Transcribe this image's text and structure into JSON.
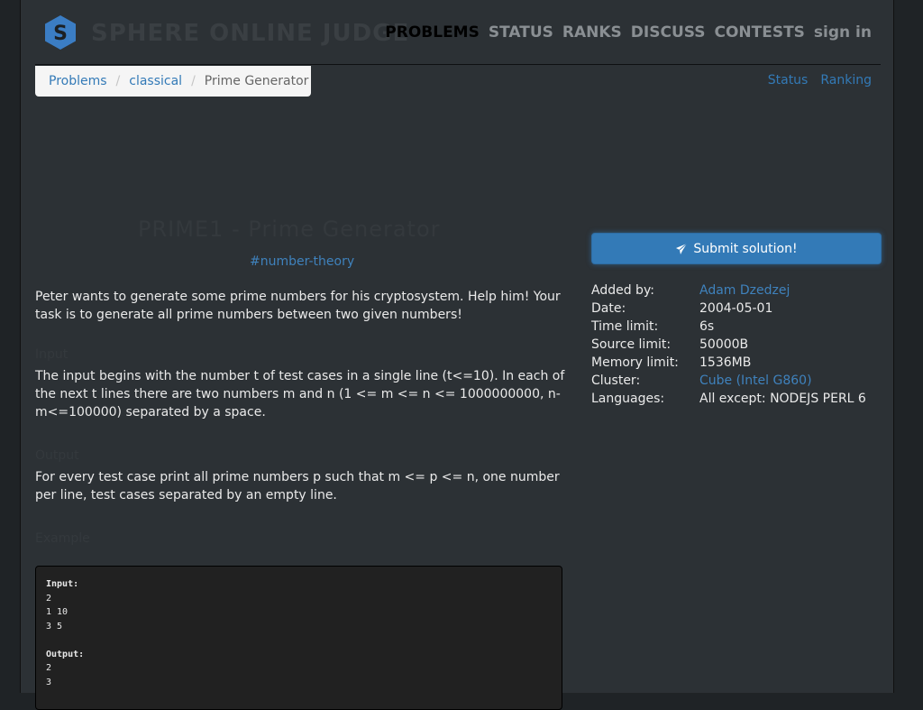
{
  "header": {
    "logo_letter": "S",
    "logo_text": "SPHERE ONLINE JUDGE",
    "nav": [
      {
        "label": "PROBLEMS",
        "active": true
      },
      {
        "label": "STATUS",
        "active": false
      },
      {
        "label": "RANKS",
        "active": false
      },
      {
        "label": "DISCUSS",
        "active": false
      },
      {
        "label": "CONTESTS",
        "active": false
      },
      {
        "label": "sign in",
        "active": false
      }
    ]
  },
  "breadcrumb": {
    "items": [
      "Problems",
      "classical"
    ],
    "current": "Prime Generator"
  },
  "top_links": [
    "Status",
    "Ranking"
  ],
  "problem": {
    "title": "PRIME1 - Prime Generator",
    "tag": "#number-theory",
    "intro": "Peter wants to generate some prime numbers for his cryptosystem. Help him! Your task is to generate all prime numbers between two given numbers!",
    "input_heading": "Input",
    "input_text": "The input begins with the number t of test cases in a single line (t<=10). In each of the next t lines there are two numbers m and n (1 <= m <= n <= 1000000000, n-m<=100000) separated by a space.",
    "output_heading": "Output",
    "output_text": "For every test case print all prime numbers p such that m <= p <= n, one number per line, test cases separated by an empty line.",
    "example_heading": "Example",
    "sample": {
      "input_label": "Input:",
      "input_lines": [
        "2",
        "1 10",
        "3 5"
      ],
      "output_label": "Output:",
      "output_lines": [
        "2",
        "3"
      ]
    }
  },
  "sidebar": {
    "submit_label": "Submit solution!",
    "info": [
      {
        "key": "Added by:",
        "value": "Adam Dzedzej",
        "link": true
      },
      {
        "key": "Date:",
        "value": "2004-05-01",
        "link": false
      },
      {
        "key": "Time limit:",
        "value": "6s",
        "link": false
      },
      {
        "key": "Source limit:",
        "value": "50000B",
        "link": false
      },
      {
        "key": "Memory limit:",
        "value": "1536MB",
        "link": false
      },
      {
        "key": "Cluster:",
        "value": "Cube (Intel G860)",
        "link": true
      },
      {
        "key": "Languages:",
        "value": "All except: NODEJS PERL 6",
        "link": false
      }
    ]
  },
  "colors": {
    "accent": "#337ab7",
    "link": "#3f82bd",
    "page_bg": "#2c3135",
    "outer_bg": "#1f2326"
  }
}
